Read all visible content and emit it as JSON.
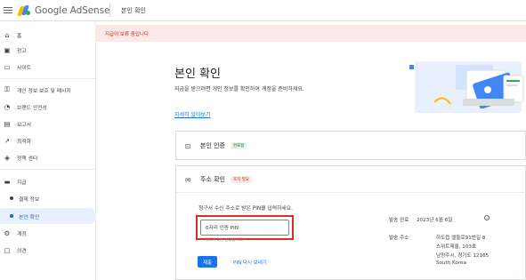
{
  "app": {
    "brand": "Google AdSense",
    "page_crumb": "본인 확인"
  },
  "banner": {
    "text": "지급이 보류 중입니다"
  },
  "sidebar": {
    "items": [
      {
        "label": "홈",
        "icon": "home-icon"
      },
      {
        "label": "광고",
        "icon": "ads-icon"
      },
      {
        "label": "사이트",
        "icon": "sites-icon"
      },
      {
        "label": "개인 정보 보호 및 메시지",
        "icon": "privacy-icon"
      },
      {
        "label": "브랜드 안전성",
        "icon": "brand-safety-icon"
      },
      {
        "label": "보고서",
        "icon": "reports-icon"
      },
      {
        "label": "최적화",
        "icon": "optimization-icon"
      },
      {
        "label": "정책 센터",
        "icon": "policy-icon"
      },
      {
        "label": "지급",
        "icon": "payments-icon"
      },
      {
        "label": "결제 정보",
        "icon": "dot"
      },
      {
        "label": "본인 확인",
        "icon": "dot"
      },
      {
        "label": "계정",
        "icon": "account-icon"
      },
      {
        "label": "의견",
        "icon": "feedback-icon"
      }
    ]
  },
  "main": {
    "title": "본인 확인",
    "intro": "지급을 받으려면 개인 정보를 확인하여 계정을 준비하세요.",
    "learn_more": "자세히 알아보기",
    "identity_card": {
      "title": "본인 인증",
      "status": "완료됨"
    },
    "address_card": {
      "title": "주소 확인",
      "status": "조치 필요",
      "pin_label": "청구서 수신 주소로 받은 PIN을 입력하세요.",
      "pin_placeholder": "6자리 인증 PIN",
      "pin_hint": "지도가 1번 남았습니다.",
      "confirm_button": "제출",
      "resend_link": "PIN 다시 보내기",
      "sent_label": "발송 완료",
      "sent_date": "2023년 6월 6일",
      "address_label": "발송 주소",
      "address_lines": [
        "하도읍 엘들로91번길 8",
        "스위트제율, 103호",
        "남양주시, 경기도 12165",
        "South Korea"
      ]
    }
  },
  "colors": {
    "accent": "#1a73e8",
    "error": "#d93025",
    "banner_bg": "#fce8e6"
  }
}
